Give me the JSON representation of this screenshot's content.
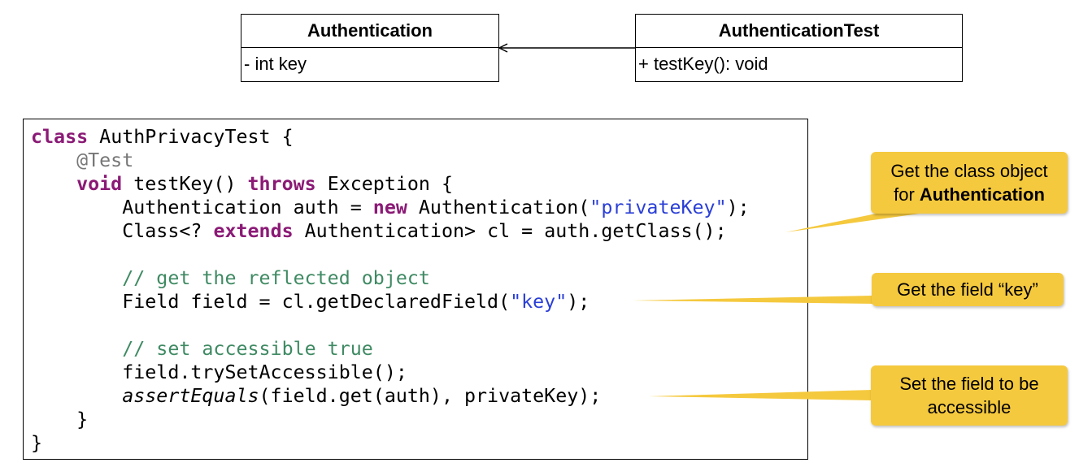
{
  "uml": {
    "authentication": {
      "title": "Authentication",
      "member": "- int key"
    },
    "test": {
      "title": "AuthenticationTest",
      "member": "+ testKey(): void"
    }
  },
  "code": {
    "l1_kw": "class",
    "l1_rest": " AuthPrivacyTest {",
    "l2_ann": "@Test",
    "l3_kw1": "void",
    "l3_mid": " testKey() ",
    "l3_kw2": "throws",
    "l3_rest": " Exception {",
    "l4_a": "Authentication auth = ",
    "l4_kw": "new",
    "l4_b": " Authentication(",
    "l4_str": "\"privateKey\"",
    "l4_c": ");",
    "l5_a": "Class<? ",
    "l5_kw": "extends",
    "l5_b": " Authentication> cl = auth.getClass();",
    "l7_cmt": "// get the reflected object",
    "l8_a": "Field field = cl.getDeclaredField(",
    "l8_str": "\"key\"",
    "l8_b": ");",
    "l10_cmt": "// set accessible true",
    "l11": "field.trySetAccessible();",
    "l12_it": "assertEquals",
    "l12_rest": "(field.get(auth), privateKey);",
    "l13": "}",
    "l14": "}"
  },
  "callouts": {
    "c1_line1": "Get the class object",
    "c1_line2_pre": "for ",
    "c1_line2_bold": "Authentication",
    "c2": "Get the field “key”",
    "c3": "Set the field to be accessible"
  },
  "colors": {
    "keyword": "#8b1a76",
    "string": "#2a3fd6",
    "comment": "#3f8a63",
    "annotation": "#777777",
    "callout": "#f5c93e"
  }
}
